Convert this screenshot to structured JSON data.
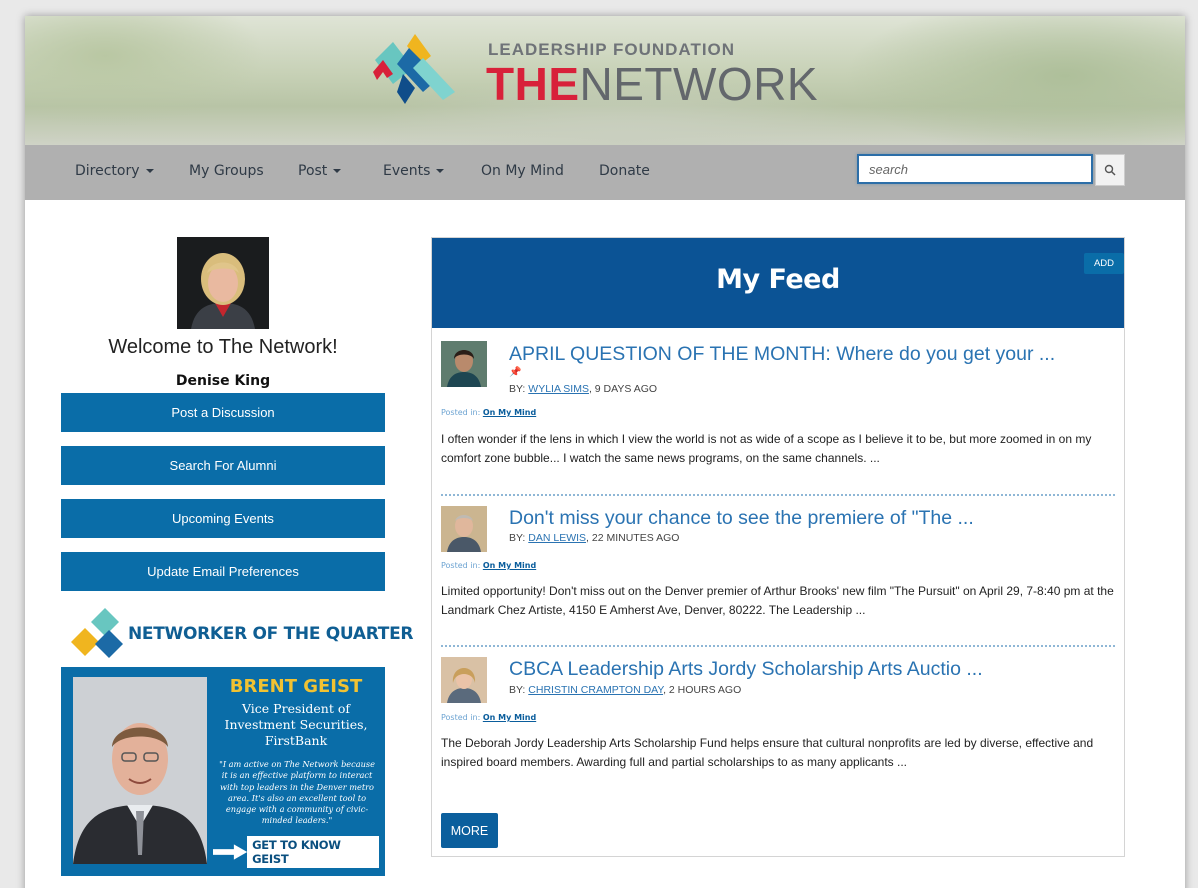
{
  "brand": {
    "top_line": "LEADERSHIP FOUNDATION",
    "main_the": "THE",
    "main_network": "NETWORK",
    "colors": {
      "red": "#d8213a",
      "gray": "#63676c",
      "teal": "#68c6c0",
      "yellow": "#f0b51f",
      "blue": "#1c6aa6"
    }
  },
  "nav": {
    "items": [
      {
        "label": "Directory",
        "dropdown": true
      },
      {
        "label": "My Groups",
        "dropdown": false
      },
      {
        "label": "Post",
        "dropdown": true
      },
      {
        "label": "Events",
        "dropdown": true
      },
      {
        "label": "On My Mind",
        "dropdown": false
      },
      {
        "label": "Donate",
        "dropdown": false
      }
    ],
    "search_placeholder": "search",
    "search_icon": "magnifier-icon"
  },
  "sidebar": {
    "welcome": "Welcome to The Network!",
    "user_name": "Denise King",
    "buttons": [
      "Post a Discussion",
      "Search For Alumni",
      "Upcoming Events",
      "Update Email Preferences"
    ],
    "networker_title": "NETWORKER OF THE QUARTER",
    "promo": {
      "name": "BRENT GEIST",
      "title": "Vice President of Investment Securities, FirstBank",
      "quote": "\"I am active on The Network because it is an effective platform to interact with top leaders in the Denver metro area. It's also an excellent tool to engage with a community of civic-minded leaders.\"",
      "cta": "GET TO KNOW GEIST"
    }
  },
  "feed": {
    "title": "My Feed",
    "add_label": "ADD",
    "posts": [
      {
        "title": "APRIL QUESTION OF THE MONTH: Where do you get your ...",
        "pinned": true,
        "by": "BY:",
        "author": "WYLIA SIMS",
        "age": ", 9 DAYS AGO",
        "posted_in": "Posted in:",
        "category": "On My Mind",
        "body": "I often wonder if the lens in which I view the world is not as wide of a scope as I believe it to be, but more zoomed in on my comfort zone bubble... I watch the same news programs, on the same channels.  ..."
      },
      {
        "title": "Don't miss your chance to see the premiere of \"The ...",
        "pinned": false,
        "by": "BY:",
        "author": "DAN LEWIS",
        "age": ", 22 MINUTES AGO",
        "posted_in": "Posted in:",
        "category": "On My Mind",
        "body": "Limited opportunity! Don't miss out on the Denver premier of Arthur Brooks' new film \"The Pursuit\" on April 29, 7-8:40 pm at the Landmark Chez Artiste, 4150 E Amherst Ave, Denver, 80222. The Leadership ..."
      },
      {
        "title": "CBCA Leadership Arts Jordy Scholarship Arts Auctio ...",
        "pinned": false,
        "by": "BY:",
        "author": "CHRISTIN CRAMPTON DAY",
        "age": ", 2 HOURS AGO",
        "posted_in": "Posted in:",
        "category": "On My Mind",
        "body": "The Deborah Jordy Leadership Arts Scholarship Fund helps ensure that cultural nonprofits are led by diverse, effective and inspired board members. Awarding full and partial scholarships to as many applicants ..."
      }
    ],
    "more_label": "MORE"
  }
}
